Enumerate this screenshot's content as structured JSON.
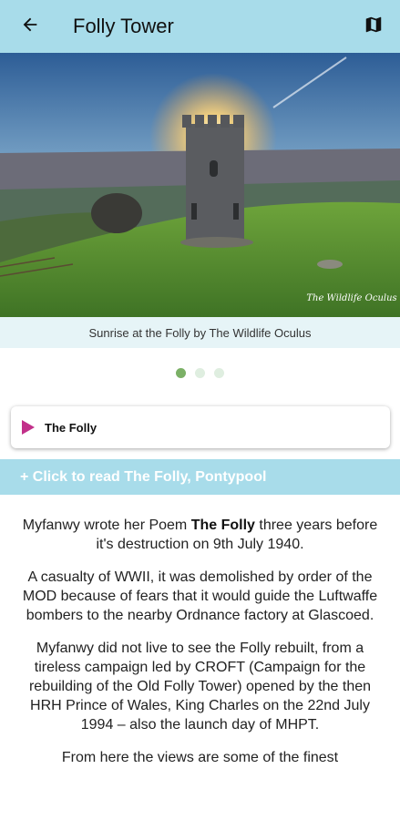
{
  "appbar": {
    "title": "Folly Tower",
    "back_icon": "arrow-left-icon",
    "map_icon": "map-icon"
  },
  "hero": {
    "watermark": "The Wildlife Oculus",
    "caption": "Sunrise at the Folly by The Wildlife Oculus"
  },
  "carousel": {
    "slides": 3,
    "active": 1
  },
  "audio": {
    "title": "The Folly",
    "icon": "play-icon"
  },
  "read_more": {
    "label": "+ Click to read The Folly, Pontypool"
  },
  "content": {
    "p1_before": "Myfanwy wrote her Poem ",
    "p1_bold": "The Folly",
    "p1_after": " three years before it's destruction on 9th July 1940.",
    "p2": "A casualty of WWII, it was demolished by order of the MOD because of fears that it would guide the Luftwaffe bombers to the nearby Ordnance factory at Glascoed.",
    "p3": "Myfanwy did not live to see the Folly rebuilt, from a tireless campaign led by CROFT (Campaign for the rebuilding of the Old Folly Tower) opened by the then HRH Prince of Wales, King Charles on the 22nd July 1994 – also the launch day of MHPT.",
    "p4": "From here the views are some of the finest"
  },
  "colors": {
    "appbar": "#a8dcea",
    "caption_bg": "#e6f4f7",
    "dot_active": "#7bb066",
    "play_icon": "#c2308a"
  }
}
